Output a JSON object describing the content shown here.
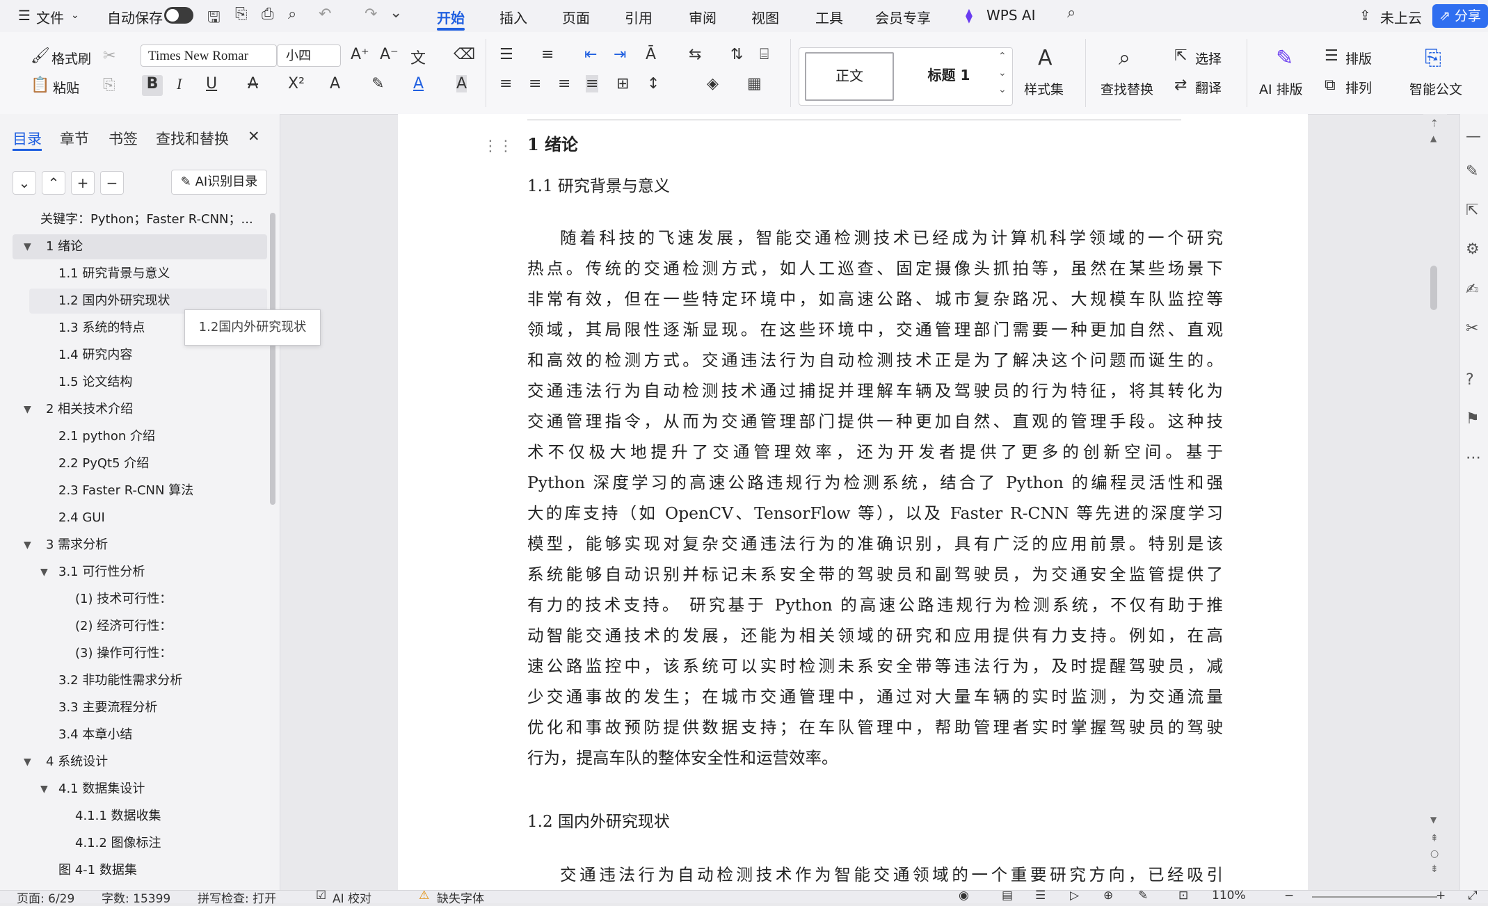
{
  "menubar": {
    "file_label": "文件",
    "autosave_label": "自动保存",
    "tabs": [
      "开始",
      "插入",
      "页面",
      "引用",
      "审阅",
      "视图",
      "工具",
      "会员专享",
      "WPS AI"
    ],
    "cloud_label": "未上云",
    "share_label": "分享"
  },
  "ribbon": {
    "format_painter": "格式刷",
    "paste": "粘贴",
    "font_name": "Times New Romar",
    "font_size": "小四",
    "style_normal": "正文",
    "style_heading1": "标题 1",
    "style_set": "样式集",
    "find_replace": "查找替换",
    "select": "选择",
    "translate": "翻译",
    "ai_layout": "AI 排版",
    "typesetting": "排版",
    "arrange": "排列",
    "smart_doc": "智能公文"
  },
  "navpane": {
    "tabs": [
      "目录",
      "章节",
      "书签",
      "查找和替换"
    ],
    "ai_toc_button": "AI识别目录",
    "tooltip": "1.2国内外研究现状",
    "toc": [
      {
        "label": "关键字：Python；Faster R-CNN；...",
        "level": 0,
        "arrow": ""
      },
      {
        "label": "1  绪论",
        "level": 1,
        "arrow": "▼",
        "selected": true
      },
      {
        "label": "1.1 研究背景与意义",
        "level": 2,
        "arrow": ""
      },
      {
        "label": "1.2 国内外研究现状",
        "level": 2,
        "arrow": "",
        "hover": true
      },
      {
        "label": "1.3 系统的特点",
        "level": 2,
        "arrow": ""
      },
      {
        "label": "1.4 研究内容",
        "level": 2,
        "arrow": ""
      },
      {
        "label": "1.5 论文结构",
        "level": 2,
        "arrow": ""
      },
      {
        "label": "2  相关技术介绍",
        "level": 1,
        "arrow": "▼"
      },
      {
        "label": "2.1 python 介绍",
        "level": 2,
        "arrow": ""
      },
      {
        "label": "2.2 PyQt5 介绍",
        "level": 2,
        "arrow": ""
      },
      {
        "label": "2.3 Faster R-CNN 算法",
        "level": 2,
        "arrow": ""
      },
      {
        "label": "2.4 GUI",
        "level": 2,
        "arrow": ""
      },
      {
        "label": "3  需求分析",
        "level": 1,
        "arrow": "▼"
      },
      {
        "label": "3.1 可行性分析",
        "level": 2,
        "arrow": "▼"
      },
      {
        "label": "(1)  技术可行性：",
        "level": 3,
        "arrow": ""
      },
      {
        "label": "(2)  经济可行性：",
        "level": 3,
        "arrow": ""
      },
      {
        "label": "(3)  操作可行性：",
        "level": 3,
        "arrow": ""
      },
      {
        "label": "3.2  非功能性需求分析",
        "level": 2,
        "arrow": ""
      },
      {
        "label": "3.3 主要流程分析",
        "level": 2,
        "arrow": ""
      },
      {
        "label": "3.4 本章小结",
        "level": 2,
        "arrow": ""
      },
      {
        "label": "4  系统设计",
        "level": 1,
        "arrow": "▼"
      },
      {
        "label": "4.1  数据集设计",
        "level": 2,
        "arrow": "▼"
      },
      {
        "label": "4.1.1 数据收集",
        "level": 3,
        "arrow": ""
      },
      {
        "label": "4.1.2 图像标注",
        "level": 3,
        "arrow": ""
      },
      {
        "label": "图 4-1  数据集",
        "level": 2,
        "arrow": ""
      }
    ]
  },
  "document": {
    "h1": "1  绪论",
    "h2_1": "1.1 研究背景与意义",
    "para1_lines": [
      "随着科技的飞速发展，智能交通检测技术已经成为计算机科学领域的一个研究",
      "热点。传统的交通检测方式，如人工巡查、固定摄像头抓拍等，虽然在某些场景下",
      "非常有效，但在一些特定环境中，如高速公路、城市复杂路况、大规模车队监控等",
      "领域，其局限性逐渐显现。在这些环境中，交通管理部门需要一种更加自然、直观",
      "和高效的检测方式。交通违法行为自动检测技术正是为了解决这个问题而诞生的。",
      "交通违法行为自动检测技术通过捕捉并理解车辆及驾驶员的行为特征，将其转化为",
      "交通管理指令，从而为交通管理部门提供一种更加自然、直观的管理手段。这种技",
      "术不仅极大地提升了交通管理效率，还为开发者提供了更多的创新空间。基于",
      "Python 深度学习的高速公路违规行为检测系统，结合了 Python 的编程灵活性和强",
      "大的库支持（如 OpenCV、TensorFlow 等），以及 Faster R-CNN 等先进的深度学习",
      "模型，能够实现对复杂交通违法行为的准确识别，具有广泛的应用前景。特别是该",
      "系统能够自动识别并标记未系安全带的驾驶员和副驾驶员，为交通安全监管提供了",
      "有力的技术支持。 研究基于 Python 的高速公路违规行为检测系统，不仅有助于推",
      "动智能交通技术的发展，还能为相关领域的研究和应用提供有力支持。例如，在高",
      "速公路监控中，该系统可以实时检测未系安全带等违法行为，及时提醒驾驶员，减",
      "少交通事故的发生；在城市交通管理中，通过对大量车辆的实时监测，为交通流量",
      "优化和事故预防提供数据支持；在车队管理中，帮助管理者实时掌握驾驶员的驾驶",
      "行为，提高车队的整体安全性和运营效率。"
    ],
    "h2_2": "1.2 国内外研究现状",
    "para2_first": "交通违法行为自动检测技术作为智能交通领域的一个重要研究方向，已经吸引"
  },
  "statusbar": {
    "page": "页面: 6/29",
    "words": "字数: 15399",
    "spellcheck": "拼写检查: 打开",
    "ai_proof": "AI 校对",
    "missing_font": "缺失字体",
    "zoom": "110%"
  }
}
